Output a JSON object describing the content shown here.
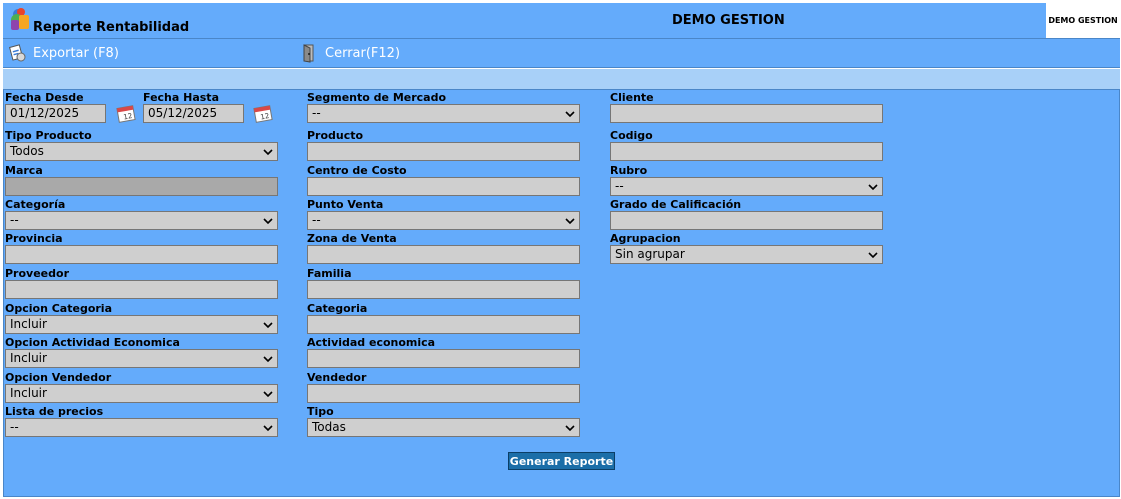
{
  "header": {
    "title": "Reporte Rentabilidad",
    "company": "DEMO GESTION",
    "logo_text": "DEMO GESTION"
  },
  "toolbar": {
    "export_label": "Exportar (F8)",
    "close_label": "Cerrar(F12)"
  },
  "form": {
    "fecha_desde": {
      "label": "Fecha Desde",
      "value": "01/12/2025"
    },
    "fecha_hasta": {
      "label": "Fecha Hasta",
      "value": "05/12/2025"
    },
    "tipo_producto": {
      "label": "Tipo Producto",
      "value": "Todos"
    },
    "marca": {
      "label": "Marca",
      "value": ""
    },
    "categoria_sel": {
      "label": "Categoría",
      "value": "--"
    },
    "provincia": {
      "label": "Provincia",
      "value": ""
    },
    "proveedor": {
      "label": "Proveedor",
      "value": ""
    },
    "opcion_categoria": {
      "label": "Opcion Categoria",
      "value": "Incluir"
    },
    "opcion_actividad": {
      "label": "Opcion Actividad Economica",
      "value": "Incluir"
    },
    "opcion_vendedor": {
      "label": "Opcion Vendedor",
      "value": "Incluir"
    },
    "lista_precios": {
      "label": "Lista de precios",
      "value": "--"
    },
    "segmento_mercado": {
      "label": "Segmento de Mercado",
      "value": "--"
    },
    "producto": {
      "label": "Producto",
      "value": ""
    },
    "centro_costo": {
      "label": "Centro de Costo",
      "value": ""
    },
    "punto_venta": {
      "label": "Punto Venta",
      "value": "--"
    },
    "zona_venta": {
      "label": "Zona de Venta",
      "value": ""
    },
    "familia": {
      "label": "Familia",
      "value": ""
    },
    "categoria_txt": {
      "label": "Categoria",
      "value": ""
    },
    "actividad_economica": {
      "label": "Actividad economica",
      "value": ""
    },
    "vendedor": {
      "label": "Vendedor",
      "value": ""
    },
    "tipo": {
      "label": "Tipo",
      "value": "Todas"
    },
    "cliente": {
      "label": "Cliente",
      "value": ""
    },
    "codigo": {
      "label": "Codigo",
      "value": ""
    },
    "rubro": {
      "label": "Rubro",
      "value": "--"
    },
    "grado_calificacion": {
      "label": "Grado de Calificación",
      "value": ""
    },
    "agrupacion": {
      "label": "Agrupacion",
      "value": "Sin agrupar"
    },
    "generate_label": "Generar Reporte"
  }
}
